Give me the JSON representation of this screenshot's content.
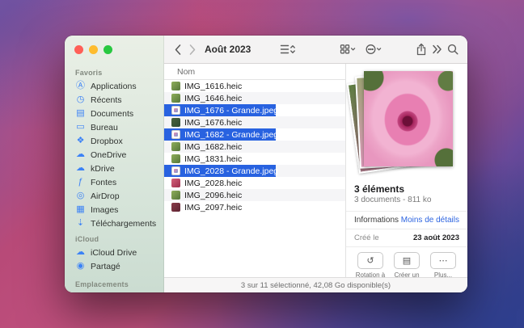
{
  "toolbar": {
    "title": "Août 2023",
    "icons": [
      "back-icon",
      "forward-icon",
      "list-view-icon",
      "group-by-icon",
      "more-options-icon",
      "share-icon",
      "toolbar-overflow-icon",
      "search-icon"
    ]
  },
  "sidebar": {
    "sections": [
      {
        "label": "Favoris",
        "items": [
          {
            "label": "Applications",
            "icon": "applications-icon",
            "glyph": "Ⓐ"
          },
          {
            "label": "Récents",
            "icon": "recents-clock-icon",
            "glyph": "◷"
          },
          {
            "label": "Documents",
            "icon": "documents-icon",
            "glyph": "▤"
          },
          {
            "label": "Bureau",
            "icon": "desktop-icon",
            "glyph": "▭"
          },
          {
            "label": "Dropbox",
            "icon": "dropbox-icon",
            "glyph": "❖"
          },
          {
            "label": "OneDrive",
            "icon": "onedrive-cloud-icon",
            "glyph": "☁"
          },
          {
            "label": "kDrive",
            "icon": "kdrive-cloud-icon",
            "glyph": "☁"
          },
          {
            "label": "Fontes",
            "icon": "fonts-icon",
            "glyph": "ƒ"
          },
          {
            "label": "AirDrop",
            "icon": "airdrop-icon",
            "glyph": "◎"
          },
          {
            "label": "Images",
            "icon": "images-icon",
            "glyph": "▦"
          },
          {
            "label": "Téléchargements",
            "icon": "downloads-icon",
            "glyph": "⇣"
          }
        ]
      },
      {
        "label": "iCloud",
        "items": [
          {
            "label": "iCloud Drive",
            "icon": "icloud-drive-icon",
            "glyph": "☁"
          },
          {
            "label": "Partagé",
            "icon": "shared-folder-icon",
            "glyph": "◉"
          }
        ]
      },
      {
        "label": "Emplacements",
        "items": []
      }
    ]
  },
  "filelist": {
    "column_header": "Nom",
    "rows": [
      {
        "name": "IMG_1616.heic",
        "selected": false,
        "tint": "green",
        "icon": "heic-thumbnail-icon"
      },
      {
        "name": "IMG_1646.heic",
        "selected": false,
        "tint": "green",
        "icon": "heic-thumbnail-icon"
      },
      {
        "name": "IMG_1676 - Grande.jpeg",
        "selected": true,
        "tint": "doc",
        "icon": "jpeg-file-icon"
      },
      {
        "name": "IMG_1676.heic",
        "selected": false,
        "tint": "dark",
        "icon": "heic-thumbnail-icon"
      },
      {
        "name": "IMG_1682 - Grande.jpeg",
        "selected": true,
        "tint": "doc",
        "icon": "jpeg-file-icon"
      },
      {
        "name": "IMG_1682.heic",
        "selected": false,
        "tint": "green",
        "icon": "heic-thumbnail-icon"
      },
      {
        "name": "IMG_1831.heic",
        "selected": false,
        "tint": "green",
        "icon": "heic-thumbnail-icon"
      },
      {
        "name": "IMG_2028 - Grande.jpeg",
        "selected": true,
        "tint": "doc",
        "icon": "jpeg-file-icon"
      },
      {
        "name": "IMG_2028.heic",
        "selected": false,
        "tint": "red",
        "icon": "heic-thumbnail-icon"
      },
      {
        "name": "IMG_2096.heic",
        "selected": false,
        "tint": "green",
        "icon": "heic-thumbnail-icon"
      },
      {
        "name": "IMG_2097.heic",
        "selected": false,
        "tint": "maroon",
        "icon": "heic-thumbnail-icon"
      }
    ]
  },
  "preview": {
    "selection_title": "3 éléments",
    "selection_subtitle": "3 documents - 811 ko",
    "info_label": "Informations",
    "details_toggle_label": "Moins de détails",
    "created_label": "Créé le",
    "created_value": "23 août 2023",
    "actions": [
      {
        "label": "Rotation à gauche",
        "icon": "rotate-left-icon",
        "glyph": "↺"
      },
      {
        "label": "Créer un PDF",
        "icon": "create-pdf-icon",
        "glyph": "▤"
      },
      {
        "label": "Plus...",
        "icon": "more-actions-icon",
        "glyph": "⋯"
      }
    ]
  },
  "statusbar": {
    "text": "3 sur 11 sélectionné, 42,08 Go disponible(s)"
  },
  "colors": {
    "selection_blue": "#2862e0",
    "sidebar_icon_blue": "#3b82f6",
    "link_blue": "#2e65e0",
    "traffic_red": "#ff5f57",
    "traffic_yellow": "#febc2e",
    "traffic_green": "#28c840"
  }
}
